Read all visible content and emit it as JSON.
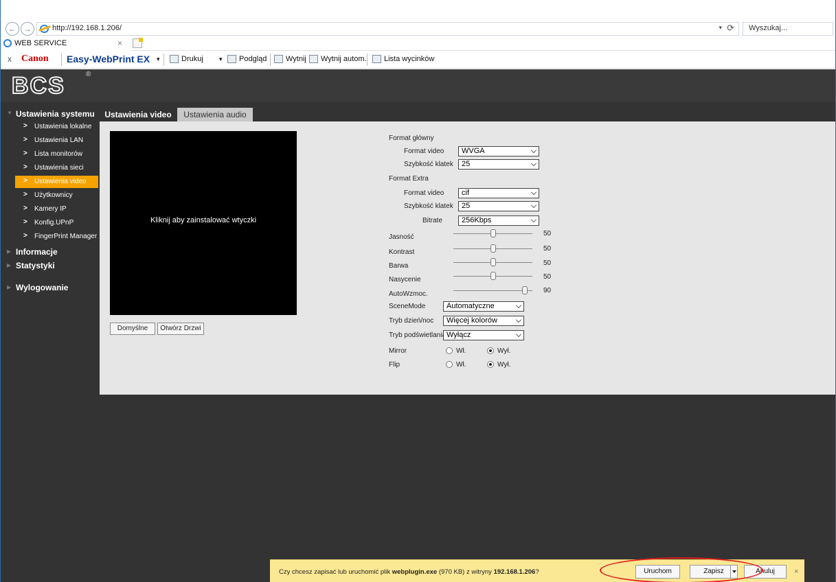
{
  "browser": {
    "url": "http://192.168.1.206/",
    "search_placeholder": "Wyszukaj...",
    "tab_title": "WEB SERVICE",
    "tab_close": "×",
    "refresh_symbol": "⟳",
    "dropdown_symbol": "▾"
  },
  "toolbar": {
    "close": "x",
    "canon": "Canon",
    "easy_webprint": "Easy-WebPrint EX",
    "drukuj": "Drukuj",
    "podglad": "Podgląd",
    "wytnij": "Wytnij",
    "wytnij_autom": "Wytnij autom.",
    "lista_wycinkow": "Lista wycinków"
  },
  "app": {
    "logo": "BCS",
    "logo_mark": "®"
  },
  "sidebar": {
    "system_settings": "Ustawienia systemu",
    "items": [
      {
        "label": "Ustawienia lokalne",
        "active": false
      },
      {
        "label": "Ustawienia LAN",
        "active": false
      },
      {
        "label": "Lista monitorów",
        "active": false
      },
      {
        "label": "Ustawienia sieci",
        "active": false
      },
      {
        "label": "Ustawienia video",
        "active": true
      },
      {
        "label": "Użytkownicy",
        "active": false
      },
      {
        "label": "Kamery IP",
        "active": false
      },
      {
        "label": "Konfig.UPnP",
        "active": false
      },
      {
        "label": "FingerPrint Manager",
        "active": false
      }
    ],
    "info": "Informacje",
    "stats": "Statystyki",
    "logout": "Wylogowanie"
  },
  "tabs": {
    "video": "Ustawienia video",
    "audio": "Ustawienia audio"
  },
  "video_panel": {
    "install_message": "Kliknij aby zainstalować wtyczki",
    "default_button": "Domyślne",
    "open_door_button": "Otwórz Drzwi"
  },
  "settings": {
    "main_format_title": "Format główny",
    "main_video_format_label": "Format video",
    "main_video_format_value": "WVGA",
    "main_frame_rate_label": "Szybkość klatek",
    "main_frame_rate_value": "25",
    "extra_format_title": "Format Extra",
    "extra_video_format_label": "Format video",
    "extra_video_format_value": "cif",
    "extra_frame_rate_label": "Szybkość klatek",
    "extra_frame_rate_value": "25",
    "bitrate_label": "Bitrate",
    "bitrate_value": "256Kbps",
    "sliders": [
      {
        "label": "Jasność",
        "value": 50
      },
      {
        "label": "Kontrast",
        "value": 50
      },
      {
        "label": "Barwa",
        "value": 50
      },
      {
        "label": "Nasycenie",
        "value": 50
      },
      {
        "label": "AutoWzmoc.",
        "value": 90
      }
    ],
    "scene_mode_label": "SceneMode",
    "scene_mode_value": "Automatyczne",
    "day_night_label": "Tryb dzień/noc",
    "day_night_value": "Więcej kolorów",
    "backlight_label": "Tryb podświetlania",
    "backlight_value": "Wyłącz",
    "mirror_label": "Mirror",
    "flip_label": "Flip",
    "on_label": "Wł.",
    "off_label": "Wył."
  },
  "download_bar": {
    "prefix": "Czy chcesz zapisać lub uruchomić plik ",
    "file_name": "webplugin.exe",
    "size": " (970 KB) z witryny ",
    "host": "192.168.1.206",
    "suffix": "?",
    "run": "Uruchom",
    "save": "Zapisz",
    "cancel": "Anuluj",
    "close": "×"
  },
  "colors": {
    "active_item": "#f5a300",
    "annotation_ellipse": "#e21b1b",
    "download_bar": "#fbe894"
  }
}
